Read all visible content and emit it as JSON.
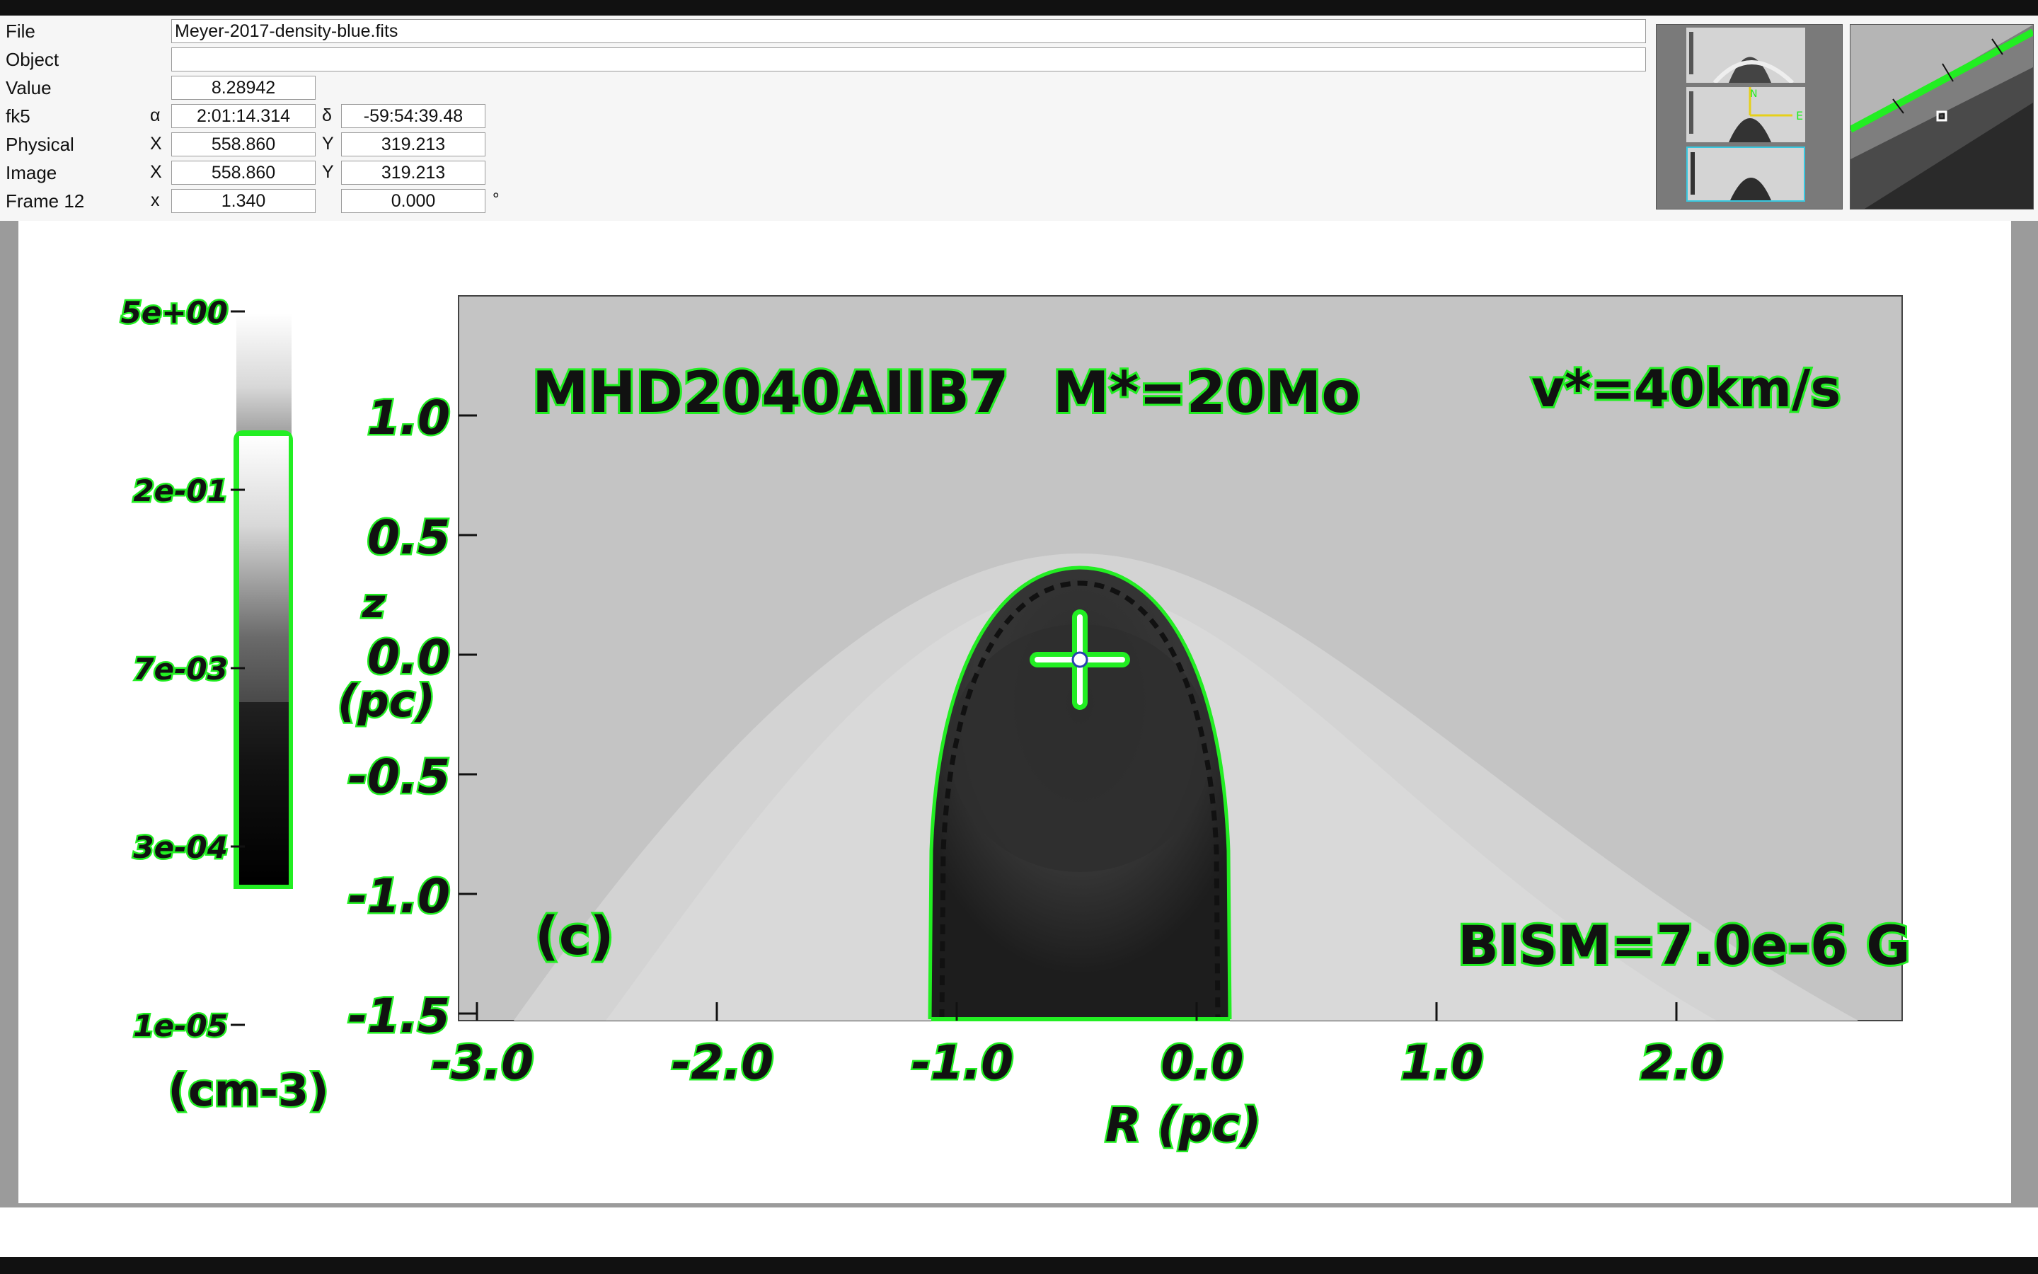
{
  "info_panel": {
    "file": {
      "label": "File",
      "value": "Meyer-2017-density-blue.fits"
    },
    "object": {
      "label": "Object",
      "value": ""
    },
    "value": {
      "label": "Value",
      "value": "8.28942"
    },
    "fk5": {
      "label": "fk5",
      "alpha_symbol": "α",
      "alpha": "2:01:14.314",
      "delta_symbol": "δ",
      "delta": "-59:54:39.48"
    },
    "physical": {
      "label": "Physical",
      "x_label": "X",
      "x": "558.860",
      "y_label": "Y",
      "y": "319.213"
    },
    "image": {
      "label": "Image",
      "x_label": "X",
      "x": "558.860",
      "y_label": "Y",
      "y": "319.213"
    },
    "frame": {
      "label": "Frame 12",
      "x_label": "x",
      "zoom": "1.340",
      "angle": "0.000",
      "angle_unit": "°"
    }
  },
  "figure": {
    "colorbar_ticks": [
      "5e+00",
      "2e-01",
      "7e-03",
      "3e-04",
      "1e-05"
    ],
    "colorbar_unit": "(cm-3)",
    "y_ticks": [
      "1.0",
      "0.5",
      "0.0",
      "-0.5",
      "-1.0",
      "-1.5"
    ],
    "y_label_top": "z",
    "y_label_unit": "(pc)",
    "x_ticks": [
      "-3.0",
      "-2.0",
      "-1.0",
      "0.0",
      "1.0",
      "2.0"
    ],
    "x_label": "R (pc)",
    "model_label": "MHD2040AIIB7",
    "mass_label": "M*=20Mo",
    "velocity_label": "v*=40km/s",
    "panel_label": "(c)",
    "field_label": "BISM=7.0e-6 G"
  },
  "colors": {
    "region_green": "#22ee22",
    "plot_background": "#c4c4c4"
  },
  "icons": {
    "crosshair": "crosshair-icon",
    "compass": "compass-icon"
  }
}
